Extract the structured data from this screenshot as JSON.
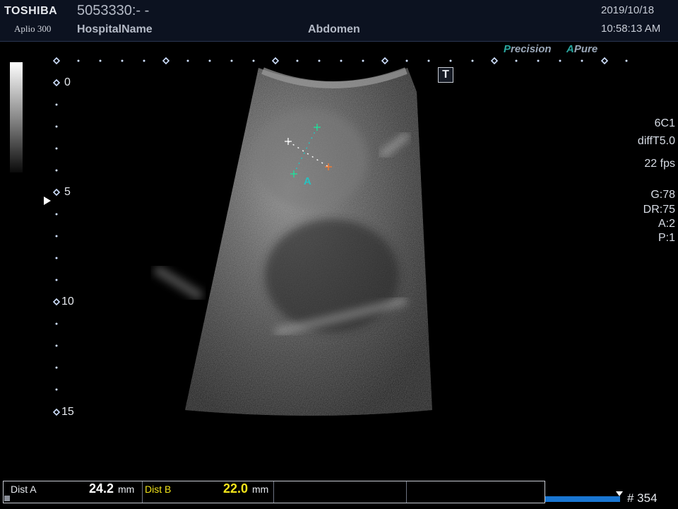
{
  "header": {
    "brand": "TOSHIBA",
    "model": "Aplio 300",
    "patient_id": "5053330:- -",
    "hospital": "HospitalName",
    "exam": "Abdomen",
    "date": "2019/10/18",
    "time": "10:58:13 AM"
  },
  "modes": {
    "precision_letter": "P",
    "precision_rest": "recision",
    "apure_letter": "A",
    "apure_rest": "Pure"
  },
  "t_icon_label": "T",
  "depth_scale": [
    "0",
    "5",
    "10",
    "15"
  ],
  "parameters": {
    "probe": "6C1",
    "mode": "diffT5.0",
    "fps": "22 fps",
    "gain": "G:78",
    "dynamic_range": "DR:75",
    "a": "A:2",
    "p": "P:1"
  },
  "measurement_marker": "A",
  "status": {
    "dist_a_label": "Dist A",
    "dist_a_value": "24.2",
    "dist_a_unit": "mm",
    "dist_b_label": "Dist B",
    "dist_b_value": "22.0",
    "dist_b_unit": "mm"
  },
  "cine": {
    "frame": "# 354"
  },
  "colors": {
    "header_bg": "#0c1220",
    "teal": "#2aa7a0",
    "dist_b_yellow": "#f2e41a",
    "cine_blue": "#1976d2"
  }
}
